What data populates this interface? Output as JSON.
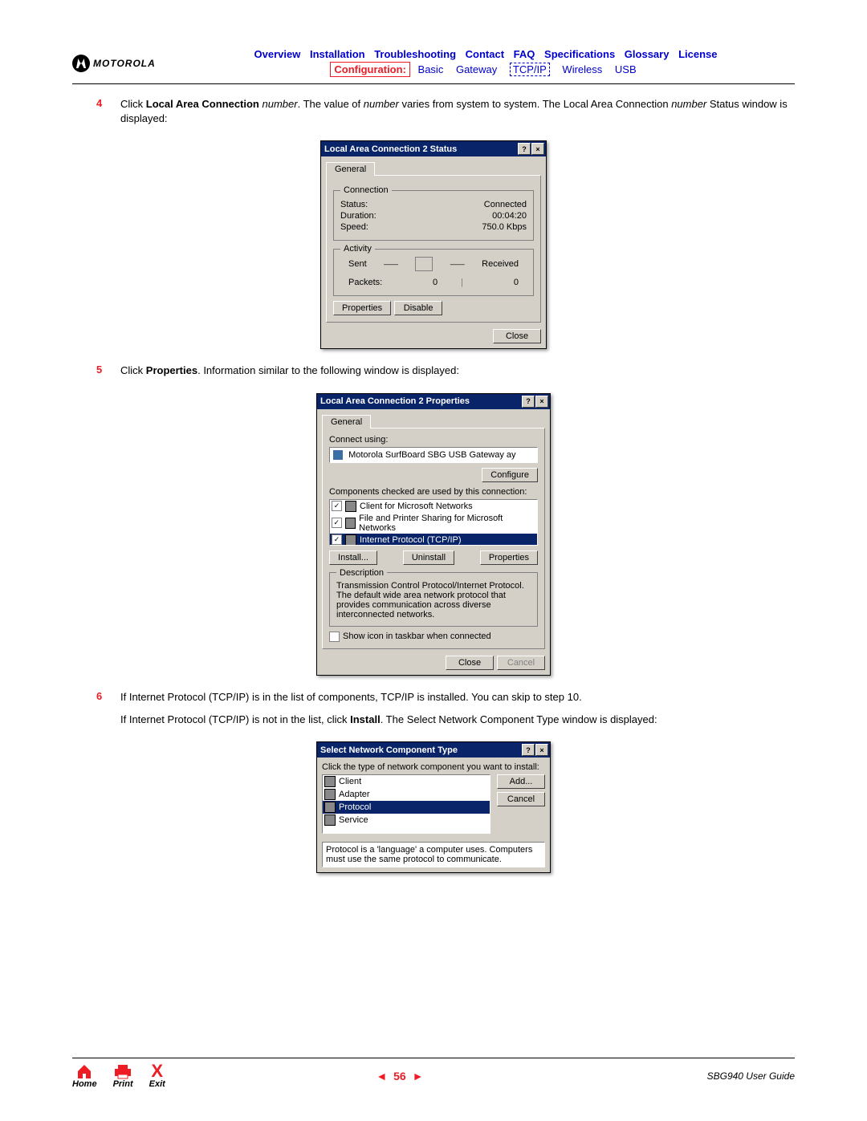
{
  "brand": "MOTOROLA",
  "nav": {
    "overview": "Overview",
    "installation": "Installation",
    "troubleshooting": "Troubleshooting",
    "contact": "Contact",
    "faq": "FAQ",
    "specifications": "Specifications",
    "glossary": "Glossary",
    "license": "License",
    "configuration": "Configuration:",
    "basic": "Basic",
    "gateway": "Gateway",
    "tcpip": "TCP/IP",
    "wireless": "Wireless",
    "usb": "USB"
  },
  "steps": {
    "s4": {
      "num": "4",
      "text_a": "Click ",
      "text_bold": "Local Area Connection",
      "text_b": " ",
      "text_italic1": "number",
      "text_c": ". The value of ",
      "text_italic2": "number",
      "text_d": " varies from system to system. The Local Area Connection ",
      "text_italic3": "number",
      "text_e": " Status window is displayed:"
    },
    "s5": {
      "num": "5",
      "text_a": "Click ",
      "text_bold": "Properties",
      "text_b": ". Information similar to the following window is displayed:"
    },
    "s6": {
      "num": "6",
      "p1": "If Internet Protocol (TCP/IP) is in the list of components, TCP/IP is installed. You can skip to step 10.",
      "p2_a": "If Internet Protocol (TCP/IP) is not in the list, click ",
      "p2_bold": "Install",
      "p2_b": ". The Select Network Component Type window is displayed:"
    }
  },
  "status_dialog": {
    "title": "Local Area Connection 2 Status",
    "tab_general": "General",
    "grp_connection": "Connection",
    "status_label": "Status:",
    "status_value": "Connected",
    "duration_label": "Duration:",
    "duration_value": "00:04:20",
    "speed_label": "Speed:",
    "speed_value": "750.0 Kbps",
    "grp_activity": "Activity",
    "sent": "Sent",
    "received": "Received",
    "packets_label": "Packets:",
    "sent_value": "0",
    "received_value": "0",
    "btn_properties": "Properties",
    "btn_disable": "Disable",
    "btn_close": "Close"
  },
  "props_dialog": {
    "title": "Local Area Connection 2 Properties",
    "tab_general": "General",
    "connect_using": "Connect using:",
    "adapter": "Motorola SurfBoard SBG USB Gateway   ay",
    "btn_configure": "Configure",
    "components_text": "Components checked are used by this connection:",
    "comp1": "Client for Microsoft Networks",
    "comp2": "File and Printer Sharing for Microsoft Networks",
    "comp3": "Internet Protocol (TCP/IP)",
    "btn_install": "Install...",
    "btn_uninstall": "Uninstall",
    "btn_properties": "Properties",
    "grp_description": "Description",
    "description": "Transmission Control Protocol/Internet Protocol. The default wide area network protocol that provides communication across diverse interconnected networks.",
    "show_icon": "Show icon in taskbar when connected",
    "btn_close": "Close",
    "btn_cancel": "Cancel"
  },
  "select_dialog": {
    "title": "Select Network Component Type",
    "instruction": "Click the type of network component you want to install:",
    "item1": "Client",
    "item2": "Adapter",
    "item3": "Protocol",
    "item4": "Service",
    "btn_add": "Add...",
    "btn_cancel": "Cancel",
    "hint": "Protocol is a 'language' a computer uses. Computers must use the same protocol to communicate."
  },
  "footer": {
    "home": "Home",
    "print": "Print",
    "exit": "Exit",
    "page_num": "56",
    "guide": "SBG940 User Guide"
  }
}
